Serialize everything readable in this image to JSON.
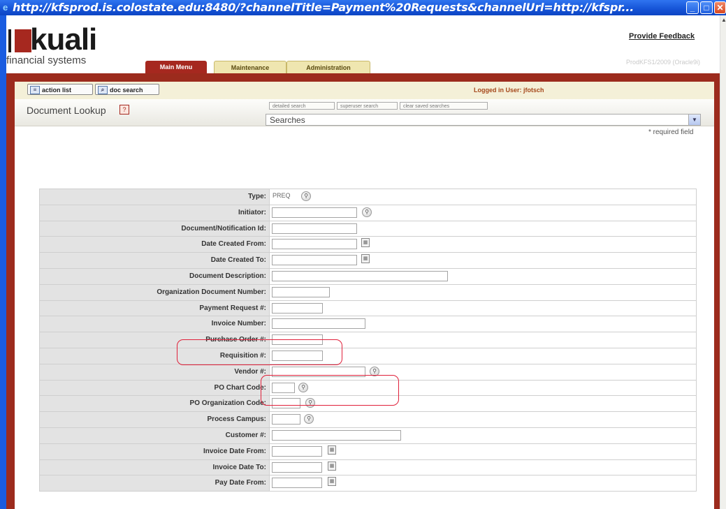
{
  "window": {
    "title": "http://kfsprod.is.colostate.edu:8480/?channelTitle=Payment%20Requests&channelUrl=http://kfspr..."
  },
  "header": {
    "logo_text": "kuali",
    "logo_sub": "financial systems",
    "provide_feedback": "Provide Feedback",
    "version_text": "ProdKFS1/2009 (Oracle9i)",
    "tabs": [
      "Main Menu",
      "Maintenance",
      "Administration"
    ]
  },
  "toolbar": {
    "action_list": "action list",
    "doc_search": "doc search",
    "logged_in": "Logged in User: jfotsch"
  },
  "lookup": {
    "title": "Document Lookup",
    "help": "?",
    "buttons": [
      "detailed search",
      "superuser search",
      "clear saved searches"
    ],
    "searches_value": "Searches",
    "required_note": "* required field"
  },
  "form": {
    "rows": [
      {
        "label": "Type:",
        "value": "PREQ"
      },
      {
        "label": "Initiator:",
        "value": ""
      },
      {
        "label": "Document/Notification Id:",
        "value": ""
      },
      {
        "label": "Date Created From:",
        "value": ""
      },
      {
        "label": "Date Created To:",
        "value": ""
      },
      {
        "label": "Document Description:",
        "value": ""
      },
      {
        "label": "Organization Document Number:",
        "value": ""
      },
      {
        "label": "Payment Request #:",
        "value": ""
      },
      {
        "label": "Invoice Number:",
        "value": ""
      },
      {
        "label": "Purchase Order #:",
        "value": ""
      },
      {
        "label": "Requisition #:",
        "value": ""
      },
      {
        "label": "Vendor #:",
        "value": ""
      },
      {
        "label": "PO Chart Code:",
        "value": ""
      },
      {
        "label": "PO Organization Code:",
        "value": ""
      },
      {
        "label": "Process Campus:",
        "value": ""
      },
      {
        "label": "Customer #:",
        "value": ""
      },
      {
        "label": "Invoice Date From:",
        "value": ""
      },
      {
        "label": "Invoice Date To:",
        "value": ""
      },
      {
        "label": "Pay Date From:",
        "value": ""
      }
    ]
  },
  "colors": {
    "kuali_red": "#a6281f",
    "frame_red": "#9c2b1d",
    "highlight": "#e0203a",
    "toolbar_bg": "#f4f0d8"
  }
}
